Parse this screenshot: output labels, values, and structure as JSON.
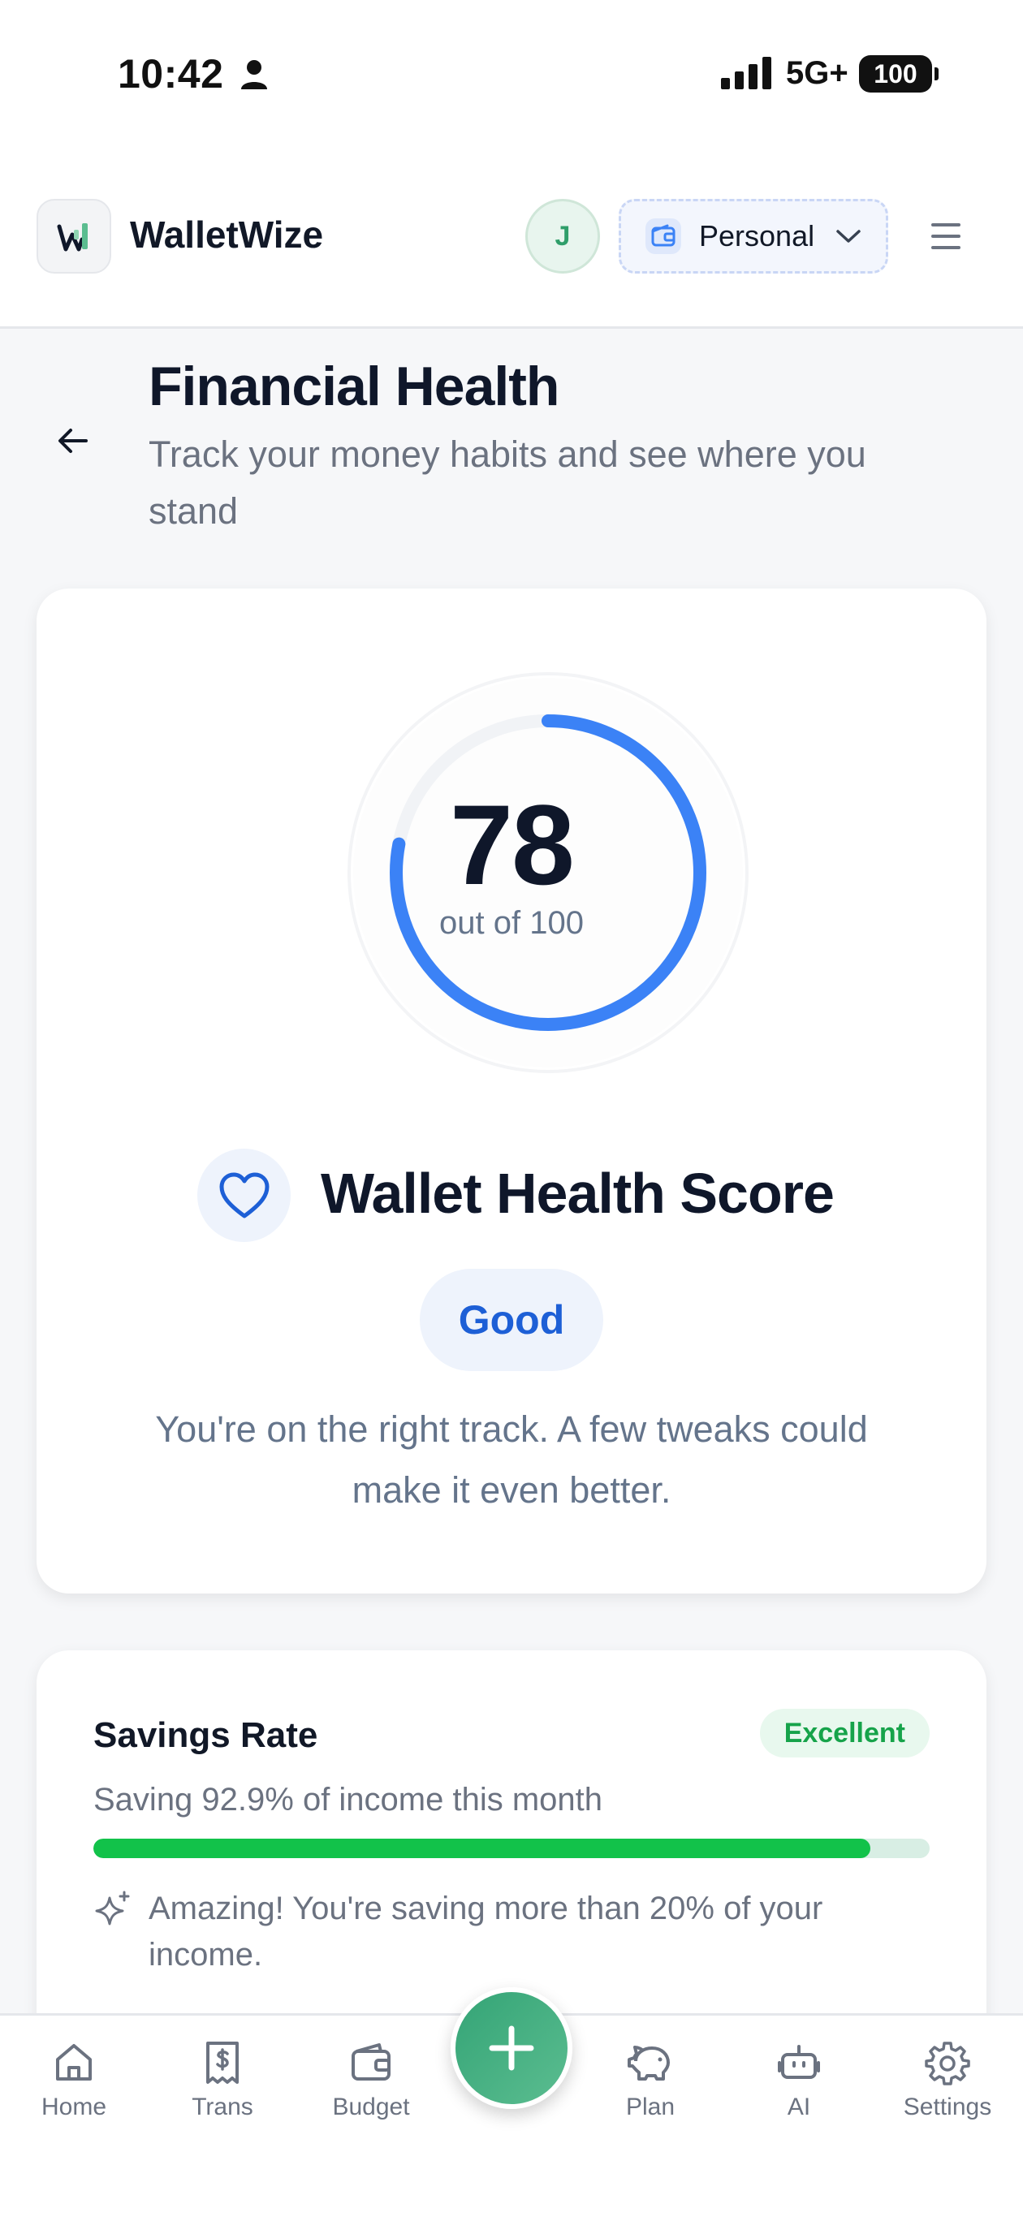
{
  "status_bar": {
    "time": "10:42",
    "network": "5G+",
    "battery": "100"
  },
  "header": {
    "app_name": "WalletWize",
    "avatar_initial": "J",
    "wallet_label": "Personal"
  },
  "page": {
    "title": "Financial Health",
    "subtitle": "Track your money habits and see where you stand"
  },
  "score_card": {
    "score": "78",
    "out_of": "out of 100",
    "score_value": 78,
    "title": "Wallet Health Score",
    "rating": "Good",
    "description": "You're on the right track. A few tweaks could make it even better."
  },
  "savings_card": {
    "title": "Savings Rate",
    "badge": "Excellent",
    "text": "Saving 92.9% of income this month",
    "progress_percent": 92.9,
    "tip": "Amazing! You're saving more than 20% of your income."
  },
  "bottom_nav": {
    "items": [
      {
        "label": "Home",
        "icon": "home-icon"
      },
      {
        "label": "Trans",
        "icon": "receipt-dollar-icon"
      },
      {
        "label": "Budget",
        "icon": "wallet-icon"
      },
      {
        "label": "Plan",
        "icon": "piggy-bank-icon"
      },
      {
        "label": "AI",
        "icon": "robot-icon"
      },
      {
        "label": "Settings",
        "icon": "gear-icon"
      }
    ],
    "fab_icon": "plus-icon"
  },
  "colors": {
    "accent_blue": "#3b82f6",
    "brand_green": "#3aa87a",
    "success_green": "#16a34a",
    "progress_green": "#12c24a"
  }
}
